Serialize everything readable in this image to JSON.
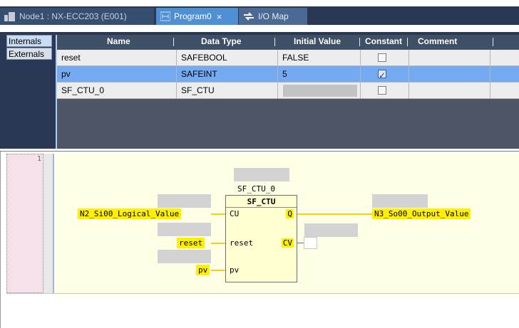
{
  "tabs": [
    {
      "label": "Node1 : NX-ECC203 (E001)",
      "active": false
    },
    {
      "label": "Program0",
      "active": true,
      "close": "×"
    },
    {
      "label": "I/O Map",
      "active": false
    }
  ],
  "side_tabs": {
    "internals": "Internals",
    "externals": "Externals"
  },
  "table": {
    "headers": {
      "name": "Name",
      "data_type": "Data Type",
      "initial_value": "Initial Value",
      "constant": "Constant",
      "comment": "Comment"
    },
    "rows": [
      {
        "name": "reset",
        "data_type": "SAFEBOOL",
        "initial_value": "FALSE",
        "constant": false,
        "selected": false
      },
      {
        "name": "pv",
        "data_type": "SAFEINT",
        "initial_value": "5",
        "constant": true,
        "selected": true
      },
      {
        "name": "SF_CTU_0",
        "data_type": "SF_CTU",
        "initial_value": "",
        "constant": false,
        "selected": false
      }
    ]
  },
  "editor": {
    "line_number": "1",
    "instance_name": "SF_CTU_0",
    "fb_type": "SF_CTU",
    "inputs": {
      "cu_var": "N2_Si00_Logical_Value",
      "reset_var": "reset",
      "pv_var": "pv"
    },
    "pins": {
      "cu": "CU",
      "reset": "reset",
      "pv": "pv",
      "q": "Q",
      "cv": "CV"
    },
    "output_var": "N3_So00_Output_Value"
  },
  "colors": {
    "tabbar": "#293955",
    "active_tab": "#4f8fd4",
    "selected_row": "#73aaf2",
    "canvas": "#ffffe6",
    "label_highlight": "#fff000",
    "wire": "#f3d11a"
  }
}
